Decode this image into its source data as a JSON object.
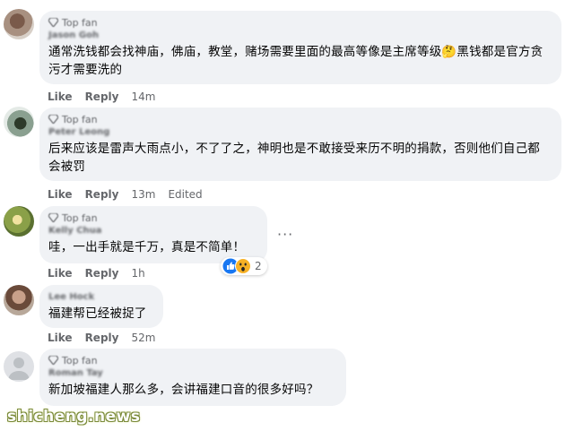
{
  "comments": [
    {
      "badge": "Top fan",
      "author": "Jason Goh",
      "text": "通常洗钱都会找神庙，佛庙，教堂，赌场需要里面的最高等像是主席等级🤔黑钱都是官方贪污才需要洗的",
      "like": "Like",
      "reply": "Reply",
      "time": "14m"
    },
    {
      "badge": "Top fan",
      "author": "Peter Leong",
      "text": "后来应该是雷声大雨点小，不了了之，神明也是不敢接受来历不明的捐款，否则他们自己都会被罚",
      "like": "Like",
      "reply": "Reply",
      "time": "13m",
      "edited": "Edited"
    },
    {
      "badge": "Top fan",
      "author": "Kelly Chua",
      "text": "哇，一出手就是千万，真是不简单！",
      "like": "Like",
      "reply": "Reply",
      "time": "1h",
      "reaction_count": "2",
      "more": "···"
    },
    {
      "author": "Lee Hock",
      "text": "福建帮已经被捉了",
      "like": "Like",
      "reply": "Reply",
      "time": "52m"
    },
    {
      "badge": "Top fan",
      "author": "Roman Tay",
      "text": "新加坡福建人那么多，会讲福建口音的很多好吗？"
    }
  ],
  "watermark": "shicheng.news",
  "colors": {
    "bubble": "#f0f2f5",
    "meta": "#65676b",
    "text": "#050505",
    "like_blue": "#1877f2",
    "wow_yellow": "#f7b125"
  }
}
